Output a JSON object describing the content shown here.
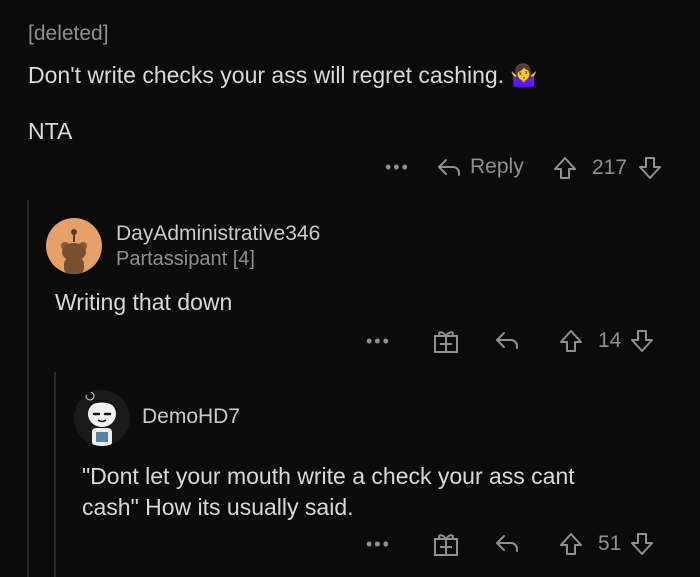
{
  "comment1": {
    "author": "[deleted]",
    "body_line1": "Don't write checks your ass will regret cashing.",
    "emoji": "🤷‍♀️",
    "body_line2": "NTA",
    "actions": {
      "more": "•••",
      "reply": "Reply",
      "votes": "217"
    }
  },
  "comment2": {
    "author": "DayAdministrative346",
    "flair": "Partassipant [4]",
    "body": "Writing that down",
    "actions": {
      "more": "•••",
      "votes": "14"
    }
  },
  "comment3": {
    "author": "DemoHD7",
    "body_line1": "\"Dont let your mouth write a check your ass cant",
    "body_line2": "cash\"  How its usually said.",
    "actions": {
      "more": "•••",
      "votes": "51"
    }
  },
  "colors": {
    "background": "#0b0b0b",
    "text": "#d7dadc",
    "muted": "#8e9093",
    "avatar1": "#e6a06a"
  }
}
